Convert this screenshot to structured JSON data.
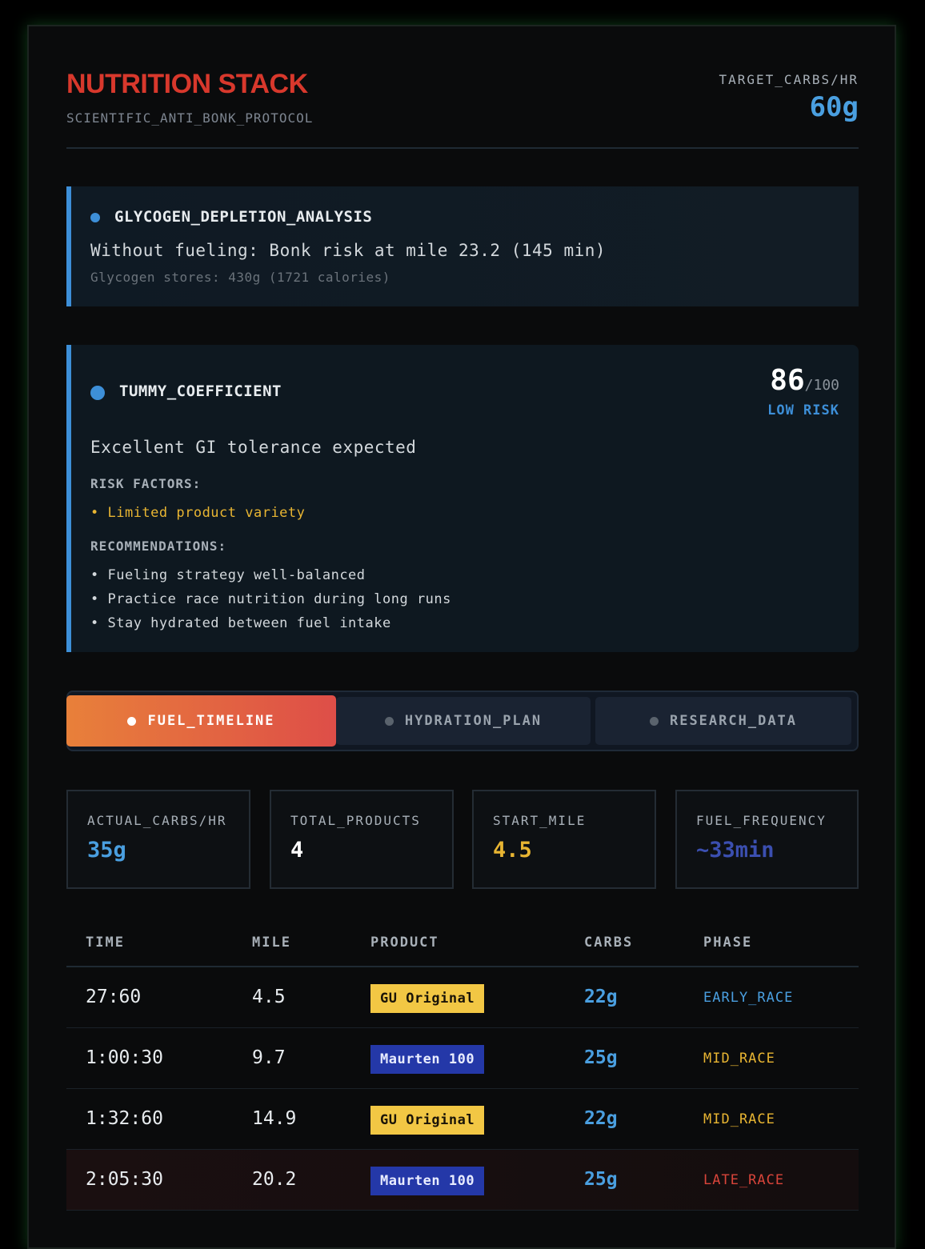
{
  "header": {
    "title": "NUTRITION STACK",
    "subtitle": "SCIENTIFIC_ANTI_BONK_PROTOCOL",
    "target_label": "TARGET_CARBS/HR",
    "target_value": "60g"
  },
  "glycogen": {
    "heading": "GLYCOGEN_DEPLETION_ANALYSIS",
    "line": "Without fueling: Bonk risk at mile 23.2 (145 min)",
    "sub": "Glycogen stores: 430g (1721 calories)"
  },
  "tummy": {
    "heading": "TUMMY_COEFFICIENT",
    "score": "86",
    "score_max": "/100",
    "risk_label": "LOW RISK",
    "description": "Excellent GI tolerance expected",
    "risk_factors_label": "RISK FACTORS:",
    "risk_factors": [
      "Limited product variety"
    ],
    "recommendations_label": "RECOMMENDATIONS:",
    "recommendations": [
      "Fueling strategy well-balanced",
      "Practice race nutrition during long runs",
      "Stay hydrated between fuel intake"
    ]
  },
  "tabs": [
    {
      "label": "FUEL_TIMELINE",
      "active": true
    },
    {
      "label": "HYDRATION_PLAN",
      "active": false
    },
    {
      "label": "RESEARCH_DATA",
      "active": false
    }
  ],
  "stats": [
    {
      "label": "ACTUAL_CARBS/HR",
      "value": "35g",
      "color": "#4a9fe0"
    },
    {
      "label": "TOTAL_PRODUCTS",
      "value": "4",
      "color": "#ffffff"
    },
    {
      "label": "START_MILE",
      "value": "4.5",
      "color": "#e8b532"
    },
    {
      "label": "FUEL_FREQUENCY",
      "value": "~33min",
      "color": "#3b4fb0"
    }
  ],
  "table": {
    "headers": [
      "TIME",
      "MILE",
      "PRODUCT",
      "CARBS",
      "PHASE"
    ],
    "rows": [
      {
        "time": "27:60",
        "mile": "4.5",
        "product": "GU Original",
        "carbs": "22g",
        "phase": "EARLY_RACE"
      },
      {
        "time": "1:00:30",
        "mile": "9.7",
        "product": "Maurten 100",
        "carbs": "25g",
        "phase": "MID_RACE"
      },
      {
        "time": "1:32:60",
        "mile": "14.9",
        "product": "GU Original",
        "carbs": "22g",
        "phase": "MID_RACE"
      },
      {
        "time": "2:05:30",
        "mile": "20.2",
        "product": "Maurten 100",
        "carbs": "25g",
        "phase": "LATE_RACE"
      }
    ]
  },
  "colors": {
    "accent_red": "#d8382c",
    "accent_blue": "#3d8fd8",
    "gu_badge_bg": "#f2c744",
    "gu_badge_text": "#1a1408",
    "maurten_badge_bg": "#2438a8",
    "maurten_badge_text": "#e8ecff",
    "phase_early": "#4a9fe0",
    "phase_mid": "#e8b532",
    "phase_late": "#d8443a"
  }
}
